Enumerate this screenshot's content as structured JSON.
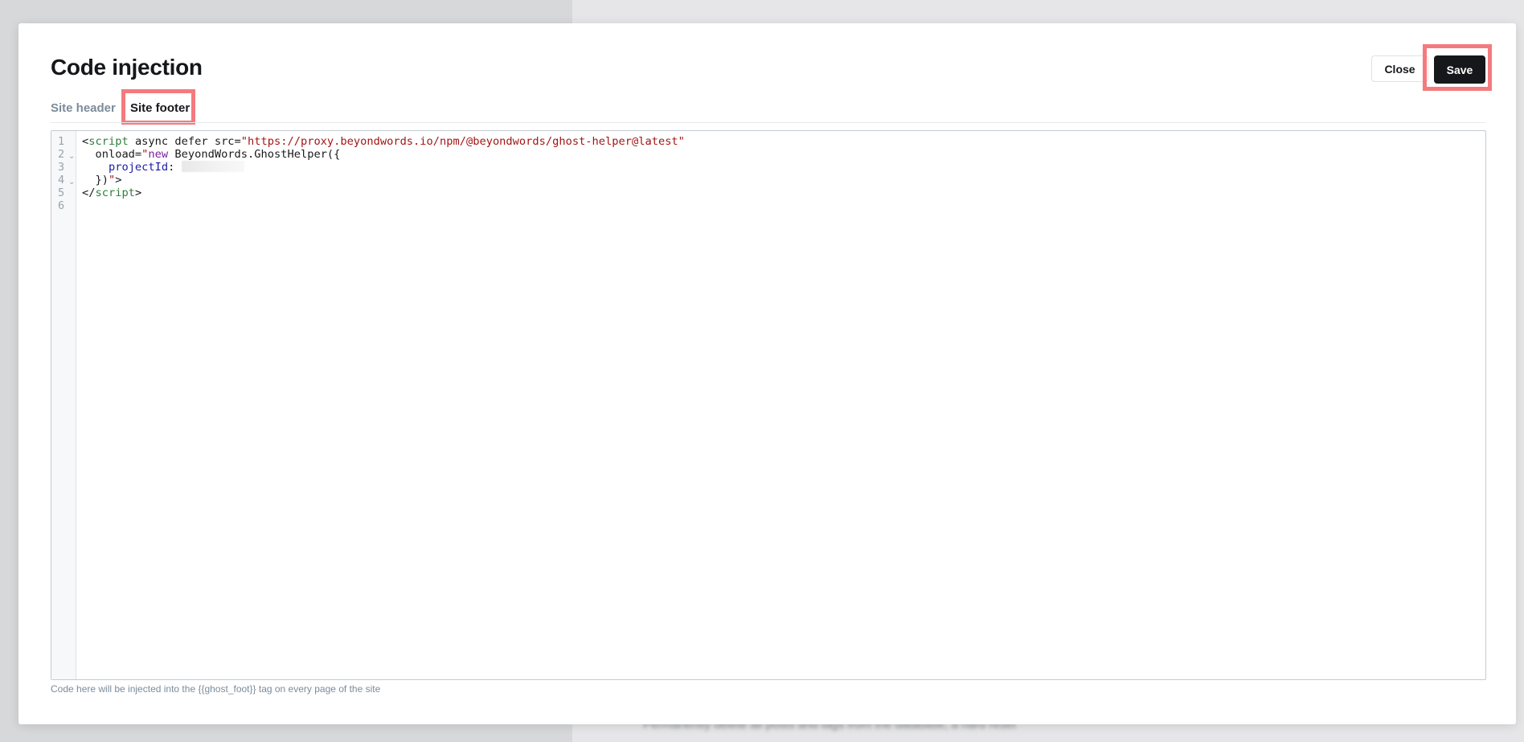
{
  "backdrop": {
    "blurred_text": "Permanently delete all posts and tags from the database, a hard reset"
  },
  "modal": {
    "title": "Code injection",
    "close_label": "Close",
    "save_label": "Save",
    "tabs": [
      {
        "label": "Site header",
        "active": false
      },
      {
        "label": "Site footer",
        "active": true
      }
    ],
    "editor": {
      "line_numbers": [
        "1",
        "2",
        "3",
        "4",
        "5",
        "6"
      ],
      "lines": [
        [
          {
            "text": "<",
            "kind": "plain"
          },
          {
            "text": "script",
            "kind": "tag"
          },
          {
            "text": " async defer src=",
            "kind": "plain"
          },
          {
            "text": "\"https://proxy.beyondwords.io/npm/@beyondwords/ghost-helper@latest\"",
            "kind": "str"
          }
        ],
        [
          {
            "text": "  onload=",
            "kind": "plain"
          },
          {
            "text": "\"",
            "kind": "str"
          },
          {
            "text": "new",
            "kind": "kw"
          },
          {
            "text": " BeyondWords.GhostHelper({",
            "kind": "plain"
          }
        ],
        [
          {
            "text": "    ",
            "kind": "plain"
          },
          {
            "text": "projectId",
            "kind": "prop"
          },
          {
            "text": ": ",
            "kind": "plain"
          }
        ],
        [
          {
            "text": "  })",
            "kind": "plain"
          },
          {
            "text": "\"",
            "kind": "str"
          },
          {
            "text": ">",
            "kind": "plain"
          }
        ],
        [
          {
            "text": "</",
            "kind": "plain"
          },
          {
            "text": "script",
            "kind": "tag"
          },
          {
            "text": ">",
            "kind": "plain"
          }
        ],
        []
      ]
    },
    "hint": "Code here will be injected into the {{ghost_foot}} tag on every page of the site"
  },
  "colors": {
    "save_bg": "#15171a",
    "highlight": "#f47a7e",
    "tag": "#2f7d3c",
    "string": "#a31515",
    "keyword": "#7a1fa2",
    "property": "#1a1aa6"
  },
  "icons": [
    "fold-chevron-icon"
  ]
}
